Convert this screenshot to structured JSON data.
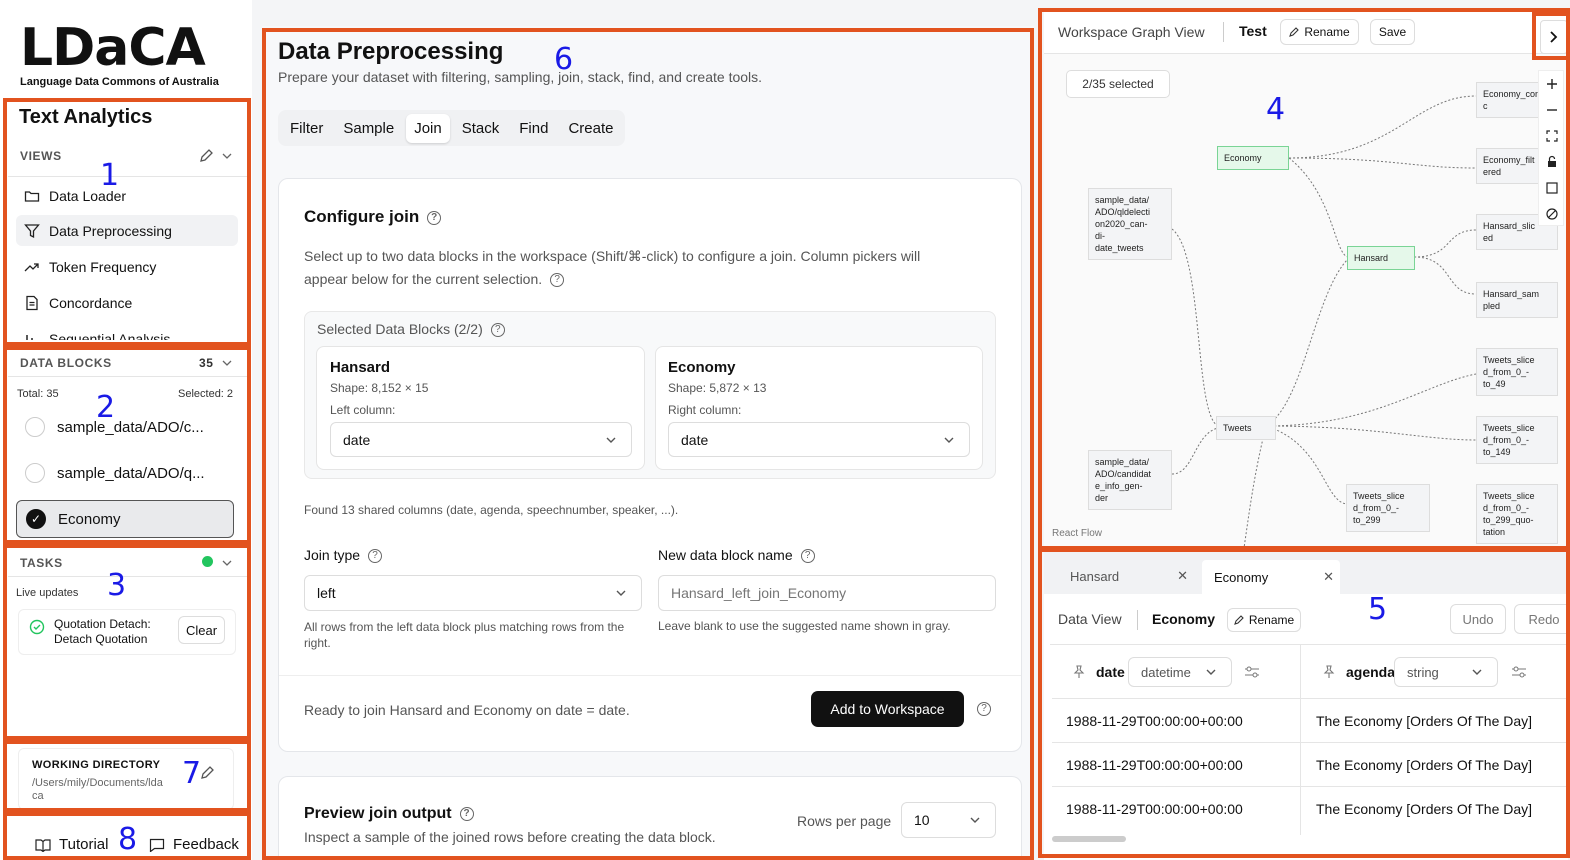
{
  "app": {
    "logo_text": "LDaCA",
    "logo_sub": "Language Data Commons of Australia",
    "title": "Text Analytics"
  },
  "views": {
    "heading": "VIEWS",
    "items": [
      {
        "label": "Data Loader",
        "icon": "folder-icon"
      },
      {
        "label": "Data Preprocessing",
        "icon": "filter-icon"
      },
      {
        "label": "Token Frequency",
        "icon": "trend-icon"
      },
      {
        "label": "Concordance",
        "icon": "document-icon"
      },
      {
        "label": "Sequential Analysis",
        "icon": "bar-icon"
      }
    ]
  },
  "data_blocks": {
    "heading": "DATA BLOCKS",
    "count": "35",
    "total": "Total: 35",
    "selected": "Selected: 2",
    "items": [
      {
        "label": "sample_data/ADO/c...",
        "checked": false
      },
      {
        "label": "sample_data/ADO/q...",
        "checked": false
      },
      {
        "label": "Economy",
        "checked": true
      }
    ]
  },
  "tasks": {
    "heading": "TASKS",
    "live": "Live updates",
    "task_line1": "Quotation Detach:",
    "task_line2": "Detach Quotation",
    "clear": "Clear",
    "status_color": "#22c55e"
  },
  "working_dir": {
    "heading": "WORKING DIRECTORY",
    "path_line1": "/Users/mily/Documents/lda",
    "path_line2": "ca"
  },
  "footer": {
    "tutorial": "Tutorial",
    "feedback": "Feedback"
  },
  "annotations": [
    "1",
    "2",
    "3",
    "4",
    "5",
    "6",
    "7",
    "8"
  ],
  "main": {
    "title": "Data Preprocessing",
    "subtitle": "Prepare your dataset with filtering, sampling, join, stack, find, and create tools.",
    "tabs": [
      "Filter",
      "Sample",
      "Join",
      "Stack",
      "Find",
      "Create"
    ],
    "active_tab": "Join",
    "configure": {
      "title": "Configure join",
      "desc_line1": "Select up to two data blocks in the workspace (Shift/⌘-click) to configure a join. Column pickers will",
      "desc_line2": "appear below for the current selection.",
      "selected_heading": "Selected Data Blocks (2/2)",
      "left": {
        "name": "Hansard",
        "shape": "Shape: 8,152 × 15",
        "col_label": "Left column:",
        "value": "date"
      },
      "right": {
        "name": "Economy",
        "shape": "Shape: 5,872 × 13",
        "col_label": "Right column:",
        "value": "date"
      },
      "shared": "Found 13 shared columns (date, agenda, speechnumber, speaker, ...).",
      "join_type_label": "Join type",
      "join_type_value": "left",
      "join_type_help": "All rows from the left data block plus matching rows from the right.",
      "new_name_label": "New data block name",
      "new_name_placeholder": "Hansard_left_join_Economy",
      "new_name_help": "Leave blank to use the suggested name shown in gray.",
      "ready": "Ready to join Hansard and Economy on date = date.",
      "add_button": "Add to Workspace"
    },
    "preview": {
      "title": "Preview join output",
      "desc": "Inspect a sample of the joined rows before creating the data block.",
      "rows_label": "Rows per page",
      "rows_value": "10"
    }
  },
  "graph": {
    "title": "Workspace Graph View",
    "name": "Test",
    "rename": "Rename",
    "save": "Save",
    "selected_badge": "2/35 selected",
    "react_flow": "React Flow",
    "nodes": [
      {
        "lines": [
          "Economy_con",
          "c"
        ]
      },
      {
        "lines": [
          "Economy_filt",
          "ered"
        ]
      },
      {
        "lines": [
          "Economy"
        ]
      },
      {
        "lines": [
          "sample_data/",
          "ADO/qldelecti",
          "on2020_can-",
          "di-",
          "date_tweets"
        ]
      },
      {
        "lines": [
          "Hansard_slic",
          "ed"
        ]
      },
      {
        "lines": [
          "Hansard"
        ]
      },
      {
        "lines": [
          "Hansard_sam",
          "pled"
        ]
      },
      {
        "lines": [
          "Tweets_slice",
          "d_from_0_-",
          "to_49"
        ]
      },
      {
        "lines": [
          "Tweets"
        ]
      },
      {
        "lines": [
          "Tweets_slice",
          "d_from_0_-",
          "to_149"
        ]
      },
      {
        "lines": [
          "sample_data/",
          "ADO/candidat",
          "e_info_gen-",
          "der"
        ]
      },
      {
        "lines": [
          "Tweets_slice",
          "d_from_0_-",
          "to_299"
        ]
      },
      {
        "lines": [
          "Tweets_slice",
          "d_from_0_-",
          "to_299_quo-",
          "tation"
        ]
      }
    ]
  },
  "dataview": {
    "tabs": [
      "Hansard",
      "Economy"
    ],
    "title": "Data View",
    "name": "Economy",
    "rename": "Rename",
    "undo": "Undo",
    "redo": "Redo",
    "columns": [
      {
        "name": "date",
        "type": "datetime"
      },
      {
        "name": "agenda",
        "type": "string"
      }
    ],
    "rows": [
      [
        "1988-11-29T00:00:00+00:00",
        "The Economy [Orders Of The Day]"
      ],
      [
        "1988-11-29T00:00:00+00:00",
        "The Economy [Orders Of The Day]"
      ],
      [
        "1988-11-29T00:00:00+00:00",
        "The Economy [Orders Of The Day]"
      ]
    ]
  }
}
